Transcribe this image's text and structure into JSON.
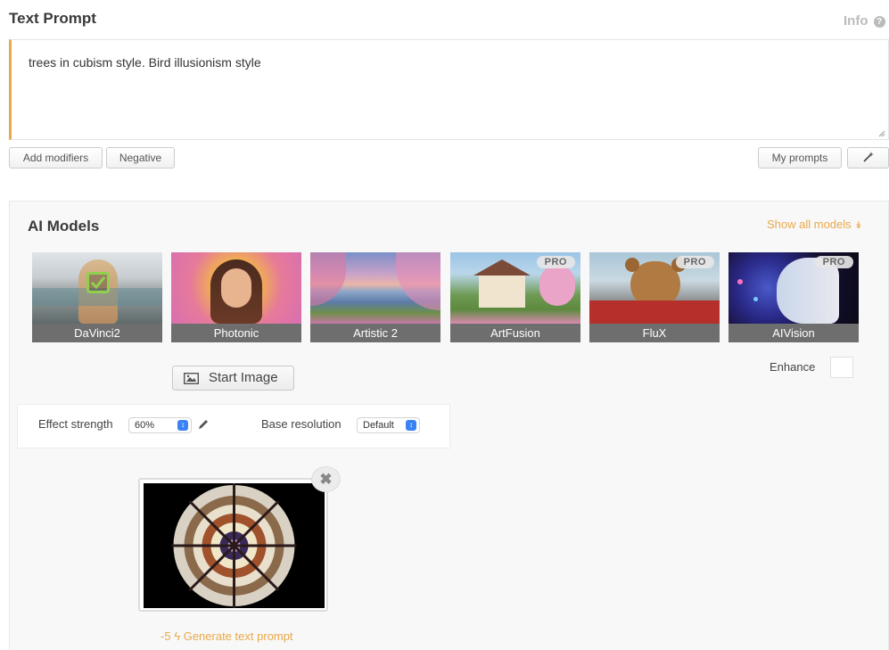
{
  "header": {
    "title": "Text Prompt",
    "info_label": "Info",
    "info_icon": "question-circle-icon"
  },
  "prompt": {
    "value": "trees in cubism style. Bird illusionism style"
  },
  "toolbar": {
    "add_modifiers": "Add modifiers",
    "negative": "Negative",
    "my_prompts": "My prompts",
    "wand_icon": "magic-wand-icon"
  },
  "models_section": {
    "title": "AI Models",
    "show_all": "Show all models",
    "show_all_icon": "double-chevron-down-icon",
    "items": [
      {
        "name": "DaVinci2",
        "selected": true,
        "pro": false
      },
      {
        "name": "Photonic",
        "selected": false,
        "pro": false
      },
      {
        "name": "Artistic 2",
        "selected": false,
        "pro": false
      },
      {
        "name": "ArtFusion",
        "selected": false,
        "pro": true
      },
      {
        "name": "FluX",
        "selected": false,
        "pro": true
      },
      {
        "name": "AIVision",
        "selected": false,
        "pro": true
      }
    ],
    "pro_badge": "PRO"
  },
  "start_image": {
    "label": "Start Image",
    "icon": "image-icon"
  },
  "enhance": {
    "label": "Enhance",
    "checked": false
  },
  "settings": {
    "effect_strength_label": "Effect strength",
    "effect_strength_value": "60%",
    "base_resolution_label": "Base resolution",
    "base_resolution_value": "Default"
  },
  "start_thumbnail": {
    "remove_icon": "close-icon"
  },
  "generate": {
    "cost": "-5",
    "bolt_icon": "lightning-bolt-icon",
    "label": "Generate text prompt"
  },
  "colors": {
    "accent": "#e9a94a",
    "select_accent": "#3b82f6",
    "label_bar": "#6e6e6e"
  }
}
